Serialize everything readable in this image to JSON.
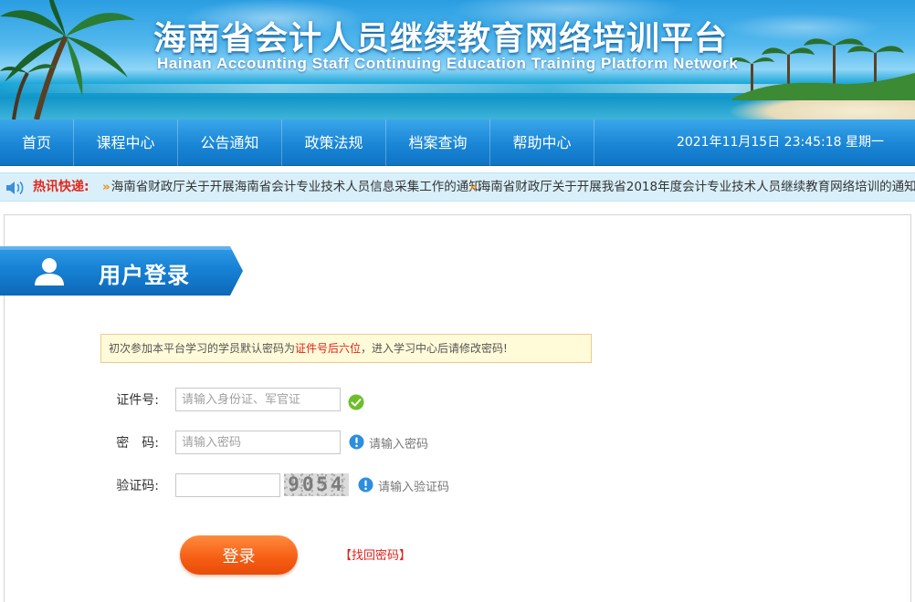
{
  "banner": {
    "title_cn": "海南省会计人员继续教育网络培训平台",
    "title_en": "Hainan Accounting Staff Continuing Education Training Platform Network"
  },
  "nav": {
    "items": [
      {
        "label": "首页"
      },
      {
        "label": "课程中心"
      },
      {
        "label": "公告通知"
      },
      {
        "label": "政策法规"
      },
      {
        "label": "档案查询"
      },
      {
        "label": "帮助中心"
      }
    ],
    "datetime": "2021年11月15日 23:45:18 星期一"
  },
  "ticker": {
    "label": "热讯快递:",
    "items": [
      {
        "text": "海南省财政厅关于开展海南省会计专业技术人员信息采集工作的通知"
      },
      {
        "text": "海南省财政厅关于开展我省2018年度会计专业技术人员继续教育网络培训的通知"
      }
    ]
  },
  "login": {
    "title": "用户登录",
    "notice_before": "初次参加本平台学习的学员默认密码为",
    "notice_highlight": "证件号后六位",
    "notice_after": "，进入学习中心后请修改密码!",
    "id_label": "证件号:",
    "id_placeholder": "请输入身份证、军官证",
    "password_label": "密　码:",
    "password_placeholder": "请输入密码",
    "password_hint": "请输入密码",
    "captcha_label": "验证码:",
    "captcha_value": "9054",
    "captcha_hint": "请输入验证码",
    "submit_label": "登录",
    "recover_label": "【找回密码】"
  },
  "colors": {
    "nav_blue": "#1a86d6",
    "ticker_red": "#e2281a",
    "button_orange": "#f55d13",
    "valid_green": "#6cbf2a",
    "info_blue": "#2b8ee0"
  }
}
